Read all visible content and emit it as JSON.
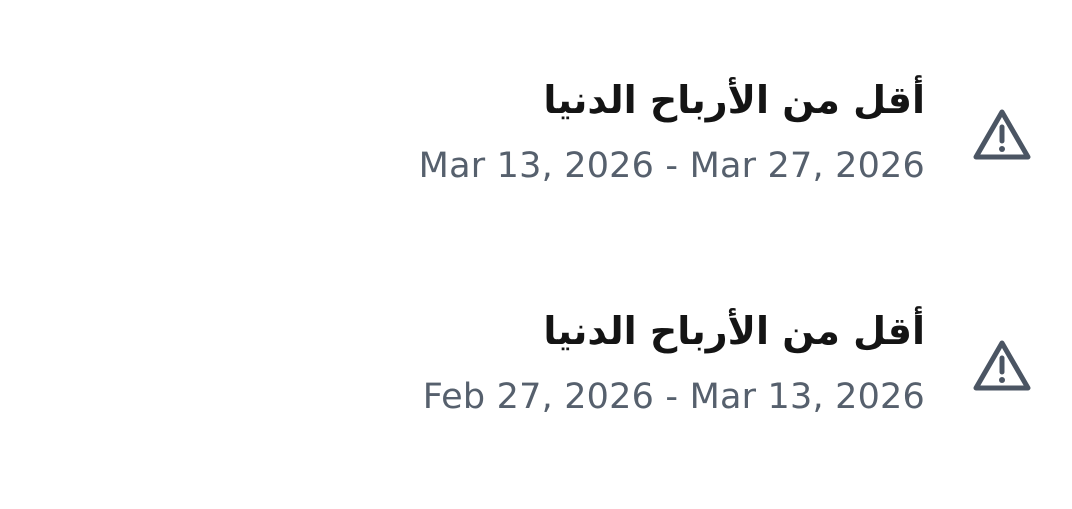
{
  "alerts": [
    {
      "title": "أقل من الأرباح الدنيا",
      "date_range": "Mar 13, 2026 - Mar 27, 2026",
      "icon": "warning-icon"
    },
    {
      "title": "أقل من الأرباح الدنيا",
      "date_range": "Feb 27, 2026 - Mar 13, 2026",
      "icon": "warning-icon"
    }
  ],
  "colors": {
    "title": "#141414",
    "dates": "#56606d",
    "icon": "#4b5563"
  }
}
